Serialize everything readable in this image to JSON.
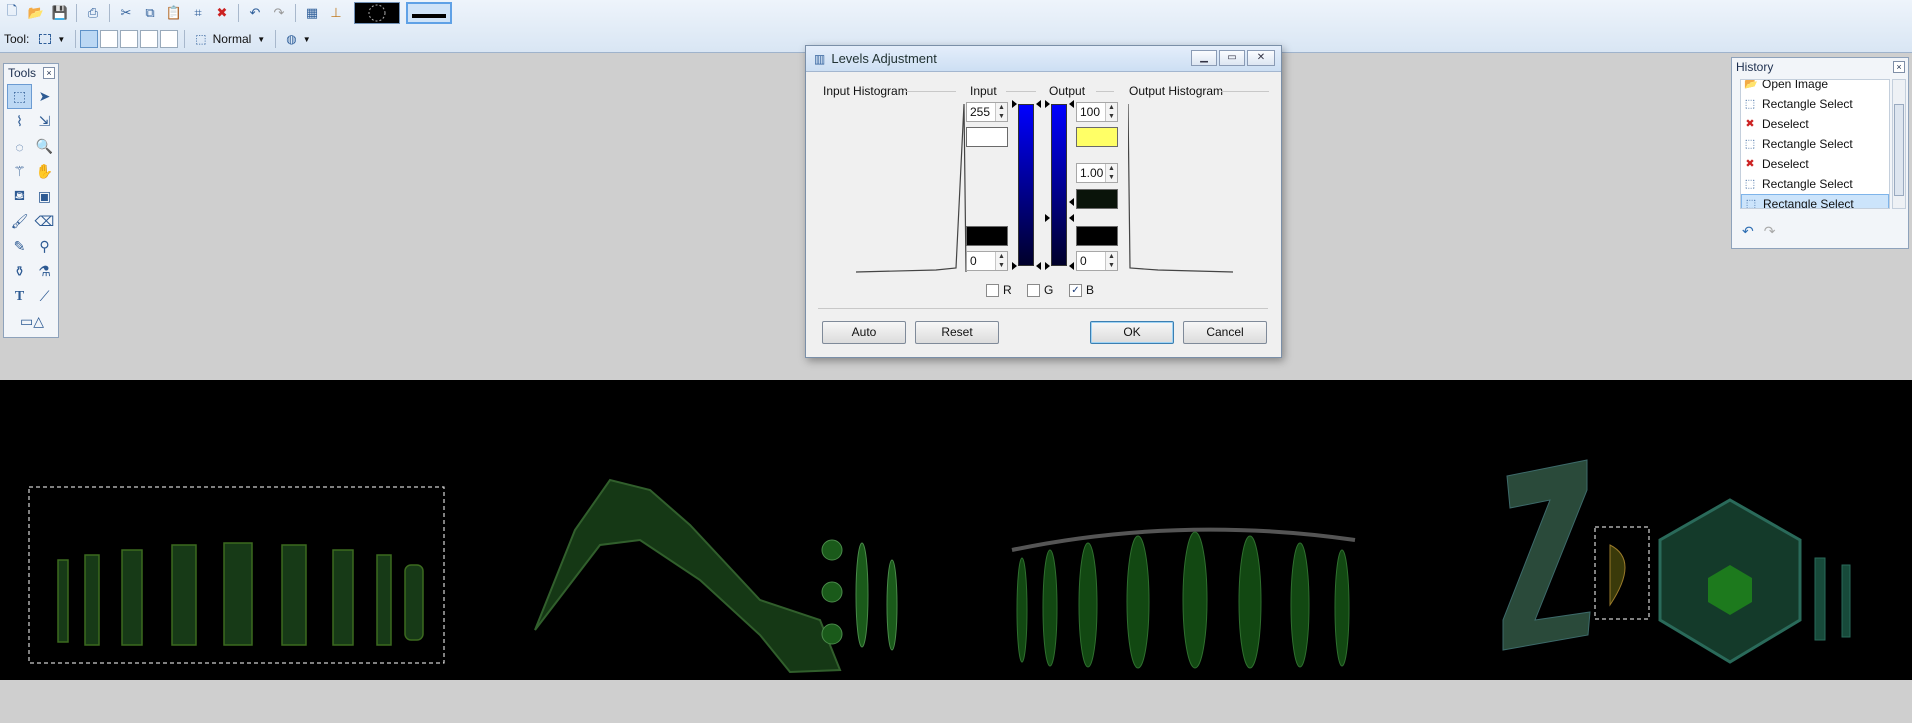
{
  "toolbar": {
    "tool_label": "Tool:",
    "blend_mode": "Normal"
  },
  "tools_panel": {
    "title": "Tools",
    "close": "×"
  },
  "levels_dialog": {
    "title": "Levels Adjustment",
    "sections": {
      "input_histogram": "Input Histogram",
      "input": "Input",
      "output": "Output",
      "output_histogram": "Output Histogram"
    },
    "input_high": "255",
    "input_low": "0",
    "output_high": "100",
    "output_gamma": "1.00",
    "output_low": "0",
    "swatch_colors": {
      "input_high": "#ffffff",
      "input_low": "#000000",
      "output_high": "#ffff66",
      "output_mid": "#0a140a",
      "output_low": "#000000"
    },
    "channels": [
      {
        "label": "R",
        "checked": false
      },
      {
        "label": "G",
        "checked": false
      },
      {
        "label": "B",
        "checked": true
      }
    ],
    "buttons": {
      "auto": "Auto",
      "reset": "Reset",
      "ok": "OK",
      "cancel": "Cancel"
    }
  },
  "history_panel": {
    "title": "History",
    "items": [
      {
        "label": "Open Image",
        "icon": "open-image-icon"
      },
      {
        "label": "Rectangle Select",
        "icon": "rectangle-select-icon"
      },
      {
        "label": "Deselect",
        "icon": "deselect-icon"
      },
      {
        "label": "Rectangle Select",
        "icon": "rectangle-select-icon"
      },
      {
        "label": "Deselect",
        "icon": "deselect-icon"
      },
      {
        "label": "Rectangle Select",
        "icon": "rectangle-select-icon"
      },
      {
        "label": "Rectangle Select",
        "icon": "rectangle-select-icon",
        "selected": true
      }
    ]
  }
}
